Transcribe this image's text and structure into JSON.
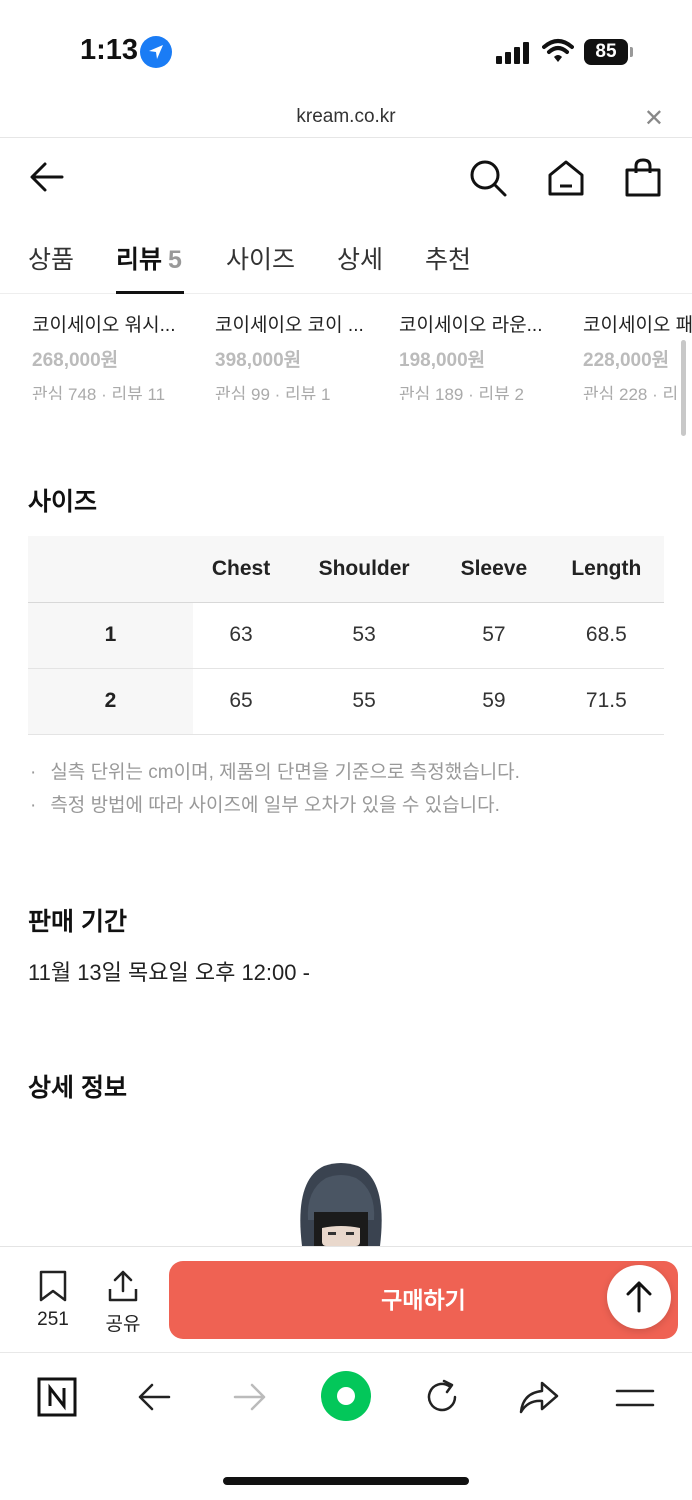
{
  "status_bar": {
    "time": "1:13",
    "battery": "85"
  },
  "browser": {
    "url": "kream.co.kr"
  },
  "tabs": [
    {
      "label": "상품"
    },
    {
      "label": "리뷰",
      "count": "5"
    },
    {
      "label": "사이즈"
    },
    {
      "label": "상세"
    },
    {
      "label": "추천"
    }
  ],
  "related_products": [
    {
      "name": "코이세이오 워시...",
      "price": "268,000원",
      "meta": "관심 748 · 리뷰 11"
    },
    {
      "name": "코이세이오 코이 ...",
      "price": "398,000원",
      "meta": "관심 99 · 리뷰 1"
    },
    {
      "name": "코이세이오 라운...",
      "price": "198,000원",
      "meta": "관심 189 · 리뷰 2"
    },
    {
      "name": "코이세이오 패",
      "price": "228,000원",
      "meta": "관심 228 · 리"
    }
  ],
  "size_section": {
    "title": "사이즈",
    "columns": [
      "",
      "Chest",
      "Shoulder",
      "Sleeve",
      "Length"
    ],
    "rows": [
      [
        "1",
        "63",
        "53",
        "57",
        "68.5"
      ],
      [
        "2",
        "65",
        "55",
        "59",
        "71.5"
      ]
    ],
    "notes": [
      "실측 단위는 cm이며, 제품의 단면을 기준으로 측정했습니다.",
      "측정 방법에 따라 사이즈에 일부 오차가 있을 수 있습니다."
    ]
  },
  "sale_period": {
    "title": "판매 기간",
    "value": "11월 13일 목요일 오후 12:00 -"
  },
  "detail_info": {
    "title": "상세 정보"
  },
  "action_bar": {
    "bookmark_count": "251",
    "share_label": "공유",
    "buy_label": "구매하기"
  },
  "colors": {
    "buy_button": "#ef6253",
    "location_badge": "#1a7cf5",
    "naver_green": "#03c75a"
  },
  "icons": [
    "back-arrow-icon",
    "search-icon",
    "home-icon",
    "shopping-bag-icon",
    "bookmark-icon",
    "share-icon",
    "scroll-top-icon",
    "naver-icon",
    "browser-back-icon",
    "browser-forward-icon",
    "naver-green-dot-icon",
    "reload-icon",
    "forward-share-icon",
    "menu-icon"
  ]
}
